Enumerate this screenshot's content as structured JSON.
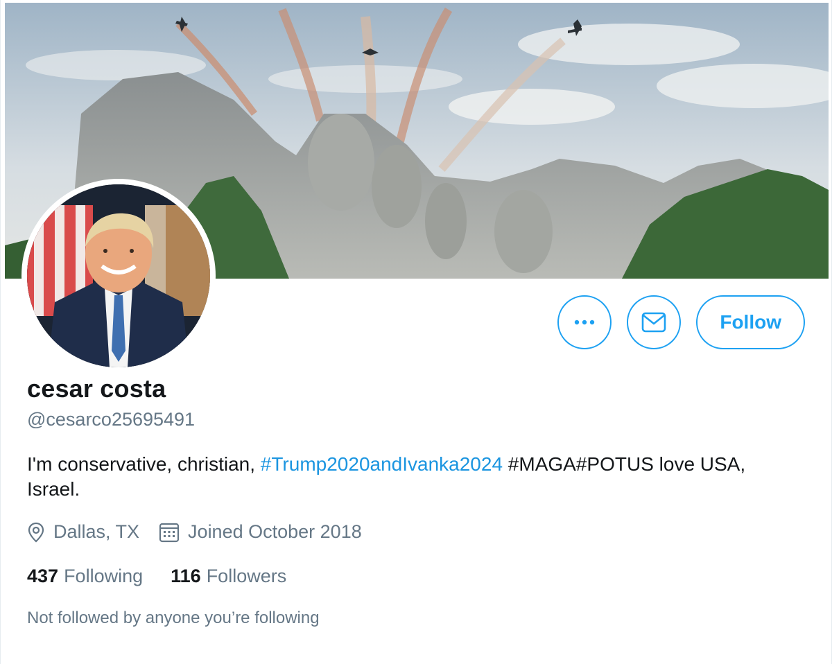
{
  "profile": {
    "display_name": "cesar costa",
    "handle": "@cesarco25695491",
    "bio": {
      "before": "I'm conservative, christian, ",
      "hashtag": "#Trump2020andIvanka2024",
      "after": " #MAGA#POTUS love USA, Israel."
    },
    "location": "Dallas, TX",
    "joined": "Joined October 2018",
    "following_count": "437",
    "following_label": "Following",
    "followers_count": "116",
    "followers_label": "Followers",
    "social_context": "Not followed by anyone you’re following"
  },
  "actions": {
    "more_icon": "more-dots-icon",
    "message_icon": "envelope-icon",
    "follow_label": "Follow"
  },
  "colors": {
    "accent": "#1da1f2",
    "hashtag": "#1b95e0",
    "secondary_text": "#657786",
    "primary_text": "#14171a"
  },
  "icons": {
    "location": "location-pin-icon",
    "joined": "calendar-icon"
  }
}
